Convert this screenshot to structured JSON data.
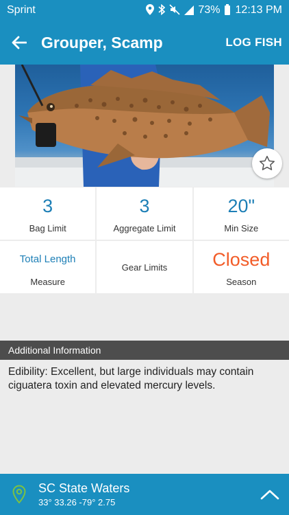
{
  "status_bar": {
    "carrier": "Sprint",
    "battery": "73%",
    "time": "12:13 PM",
    "icons": [
      "location-icon",
      "bluetooth-icon",
      "mute-icon",
      "lte-signal-icon",
      "battery-icon"
    ]
  },
  "app_bar": {
    "title": "Grouper, Scamp",
    "action_label": "LOG FISH",
    "back_icon": "back-arrow-icon"
  },
  "photo": {
    "favorite_icon": "star-outline-icon"
  },
  "regulations": [
    {
      "value": "3",
      "label": "Bag Limit"
    },
    {
      "value": "3",
      "label": "Aggregate Limit"
    },
    {
      "value": "20\"",
      "label": "Min Size"
    },
    {
      "value": "Total Length",
      "label": "Measure"
    },
    {
      "value": "",
      "label": "Gear Limits"
    },
    {
      "value": "Closed",
      "label": "Season"
    }
  ],
  "colors": {
    "primary": "#1a8fc0",
    "accent_value": "#1d7fb6",
    "closed": "#f25c28",
    "section_header": "#4d4d4d",
    "pin": "#7dc242"
  },
  "additional_info": {
    "header": "Additional Information",
    "text": "Edibility: Excellent, but large individuals may contain ciguatera toxin and elevated mercury levels."
  },
  "location": {
    "name": "SC State Waters",
    "coords": "33° 33.26  -79° 2.75",
    "pin_icon": "map-pin-icon",
    "expand_icon": "chevron-up-icon"
  }
}
